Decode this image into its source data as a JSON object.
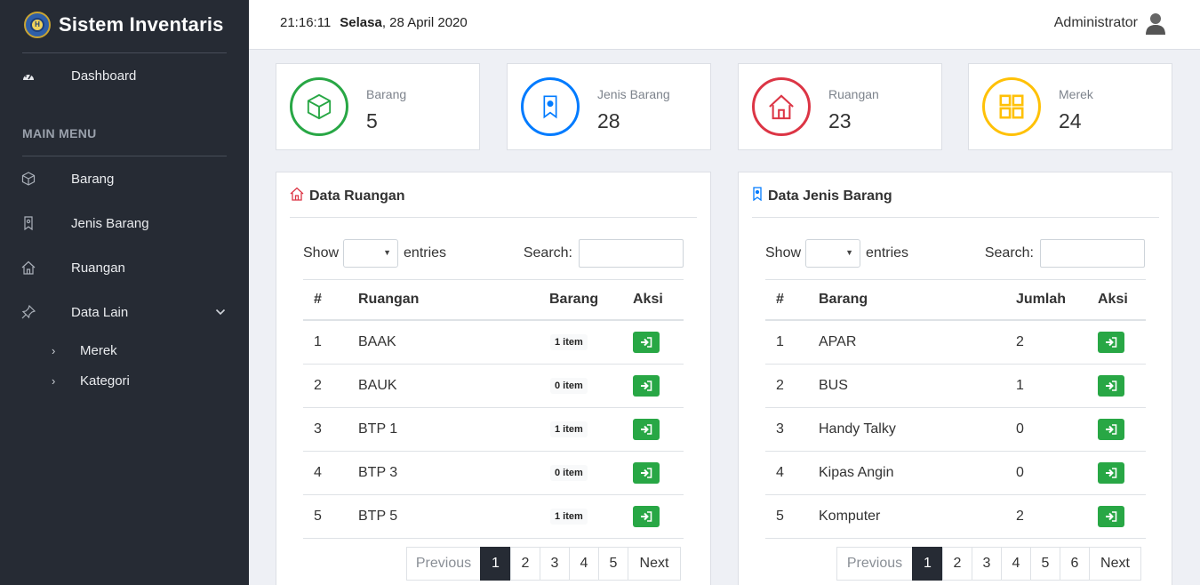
{
  "app": {
    "title": "Sistem Inventaris"
  },
  "topbar": {
    "time": "21:16:11",
    "day": "Selasa",
    "date": ", 28 April 2020",
    "user": "Administrator"
  },
  "sidebar": {
    "dashboard": "Dashboard",
    "section": "MAIN MENU",
    "items": [
      {
        "label": "Barang",
        "icon": "box-icon"
      },
      {
        "label": "Jenis Barang",
        "icon": "bookmark-icon"
      },
      {
        "label": "Ruangan",
        "icon": "home-icon"
      },
      {
        "label": "Data Lain",
        "icon": "pin-icon"
      }
    ],
    "sub_items": [
      "Merek",
      "Kategori"
    ]
  },
  "stats": [
    {
      "label": "Barang",
      "value": "5",
      "color": "#28a745",
      "icon": "box-icon"
    },
    {
      "label": "Jenis Barang",
      "value": "28",
      "color": "#007bff",
      "icon": "bookmark-icon"
    },
    {
      "label": "Ruangan",
      "value": "23",
      "color": "#dc3545",
      "icon": "home-icon"
    },
    {
      "label": "Merek",
      "value": "24",
      "color": "#ffc107",
      "icon": "windows-icon"
    }
  ],
  "ruangan": {
    "title": "Data Ruangan",
    "show": "Show",
    "entries": "entries",
    "search": "Search:",
    "headers": [
      "#",
      "Ruangan",
      "Barang",
      "Aksi"
    ],
    "rows": [
      {
        "no": "1",
        "name": "BAAK",
        "count": "1 item"
      },
      {
        "no": "2",
        "name": "BAUK",
        "count": "0 item"
      },
      {
        "no": "3",
        "name": "BTP 1",
        "count": "1 item"
      },
      {
        "no": "4",
        "name": "BTP 3",
        "count": "0 item"
      },
      {
        "no": "5",
        "name": "BTP 5",
        "count": "1 item"
      }
    ],
    "pager": {
      "prev": "Previous",
      "pages": [
        "1",
        "2",
        "3",
        "4",
        "5"
      ],
      "next": "Next",
      "active": "1"
    }
  },
  "jenis": {
    "title": "Data Jenis Barang",
    "show": "Show",
    "entries": "entries",
    "search": "Search:",
    "headers": [
      "#",
      "Barang",
      "Jumlah",
      "Aksi"
    ],
    "rows": [
      {
        "no": "1",
        "name": "APAR",
        "count": "2"
      },
      {
        "no": "2",
        "name": "BUS",
        "count": "1"
      },
      {
        "no": "3",
        "name": "Handy Talky",
        "count": "0"
      },
      {
        "no": "4",
        "name": "Kipas Angin",
        "count": "0"
      },
      {
        "no": "5",
        "name": "Komputer",
        "count": "2"
      }
    ],
    "pager": {
      "prev": "Previous",
      "pages": [
        "1",
        "2",
        "3",
        "4",
        "5",
        "6"
      ],
      "next": "Next",
      "active": "1"
    }
  }
}
